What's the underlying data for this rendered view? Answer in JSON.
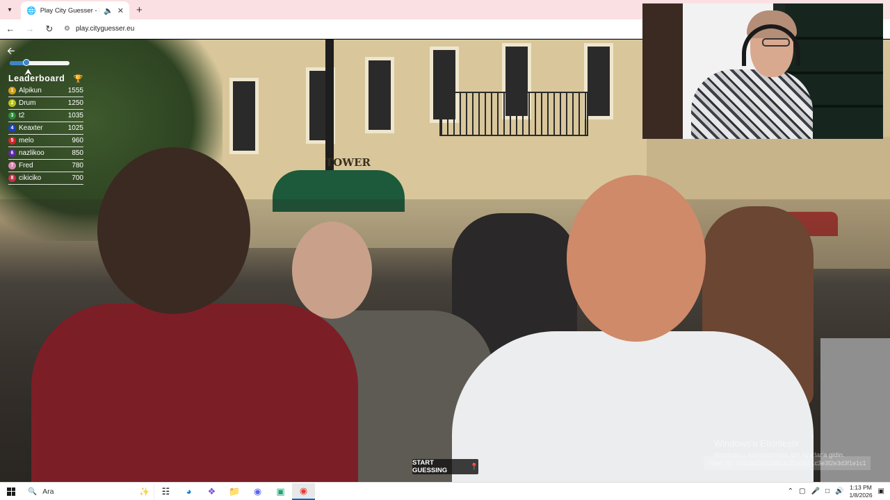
{
  "browser": {
    "tab_title": "Play City Guesser - Explore",
    "url": "play.cityguesser.eu"
  },
  "game": {
    "leaderboard_title": "Leaderboard",
    "leaderboard": [
      {
        "rank": "1",
        "name": "Alpikun",
        "score": "1555",
        "color": "#d4a017"
      },
      {
        "rank": "2",
        "name": "Drum",
        "score": "1250",
        "color": "#b6c21a"
      },
      {
        "rank": "3",
        "name": "t2",
        "score": "1035",
        "color": "#2e8b3a"
      },
      {
        "rank": "4",
        "name": "Keaxter",
        "score": "1025",
        "color": "#1f3fbf"
      },
      {
        "rank": "5",
        "name": "melo",
        "score": "960",
        "color": "#d0252b"
      },
      {
        "rank": "6",
        "name": "nazlikoo",
        "score": "850",
        "color": "#5b2aa3"
      },
      {
        "rank": "7",
        "name": "Fred",
        "score": "780",
        "color": "#d98ab3"
      },
      {
        "rank": "8",
        "name": "cikiciko",
        "score": "700",
        "color": "#c8324a"
      }
    ],
    "volume_level": 0.28,
    "start_button_label": "START GUESSING",
    "video_id": "Video ID: 2f212b252728833c2f1e2c01c3e3f2e3d3f1e1c1",
    "scene_sign_text": "TOWER"
  },
  "watermark": {
    "line1": "Windows'u Etkinleştir",
    "line2": "Windows'u etkinleştirmek için Ayarlar'a gidin."
  },
  "taskbar": {
    "search_placeholder": "Ara",
    "time": "1:13 PM",
    "date": "1/8/2026"
  },
  "colors": {
    "accent": "#3d86c6",
    "tabstrip": "#fbe0e3"
  }
}
